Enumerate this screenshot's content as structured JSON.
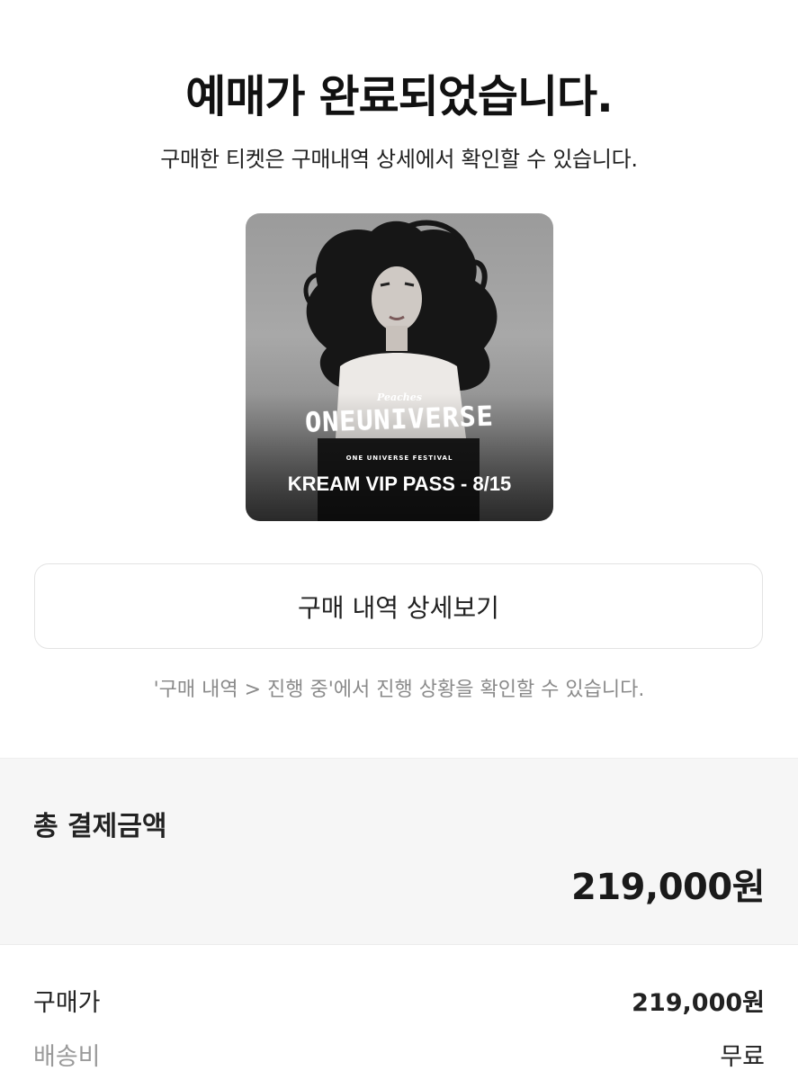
{
  "header": {
    "title": "예매가 완료되었습니다.",
    "subtitle": "구매한 티켓은 구매내역 상세에서 확인할 수 있습니다."
  },
  "poster": {
    "brand": "Peaches",
    "logo": "ONEUNIVERSE",
    "festival": "ONE UNIVERSE FESTIVAL",
    "pass_name": "KREAM VIP PASS - 8/15"
  },
  "actions": {
    "detail_button": "구매 내역 상세보기",
    "hint": "'구매 내역 > 진행 중'에서 진행 상황을 확인할 수 있습니다."
  },
  "summary": {
    "total_label": "총 결제금액",
    "total_amount": "219,000원",
    "rows": [
      {
        "label": "구매가",
        "value": "219,000원"
      },
      {
        "label": "배송비",
        "value": "무료"
      }
    ]
  }
}
